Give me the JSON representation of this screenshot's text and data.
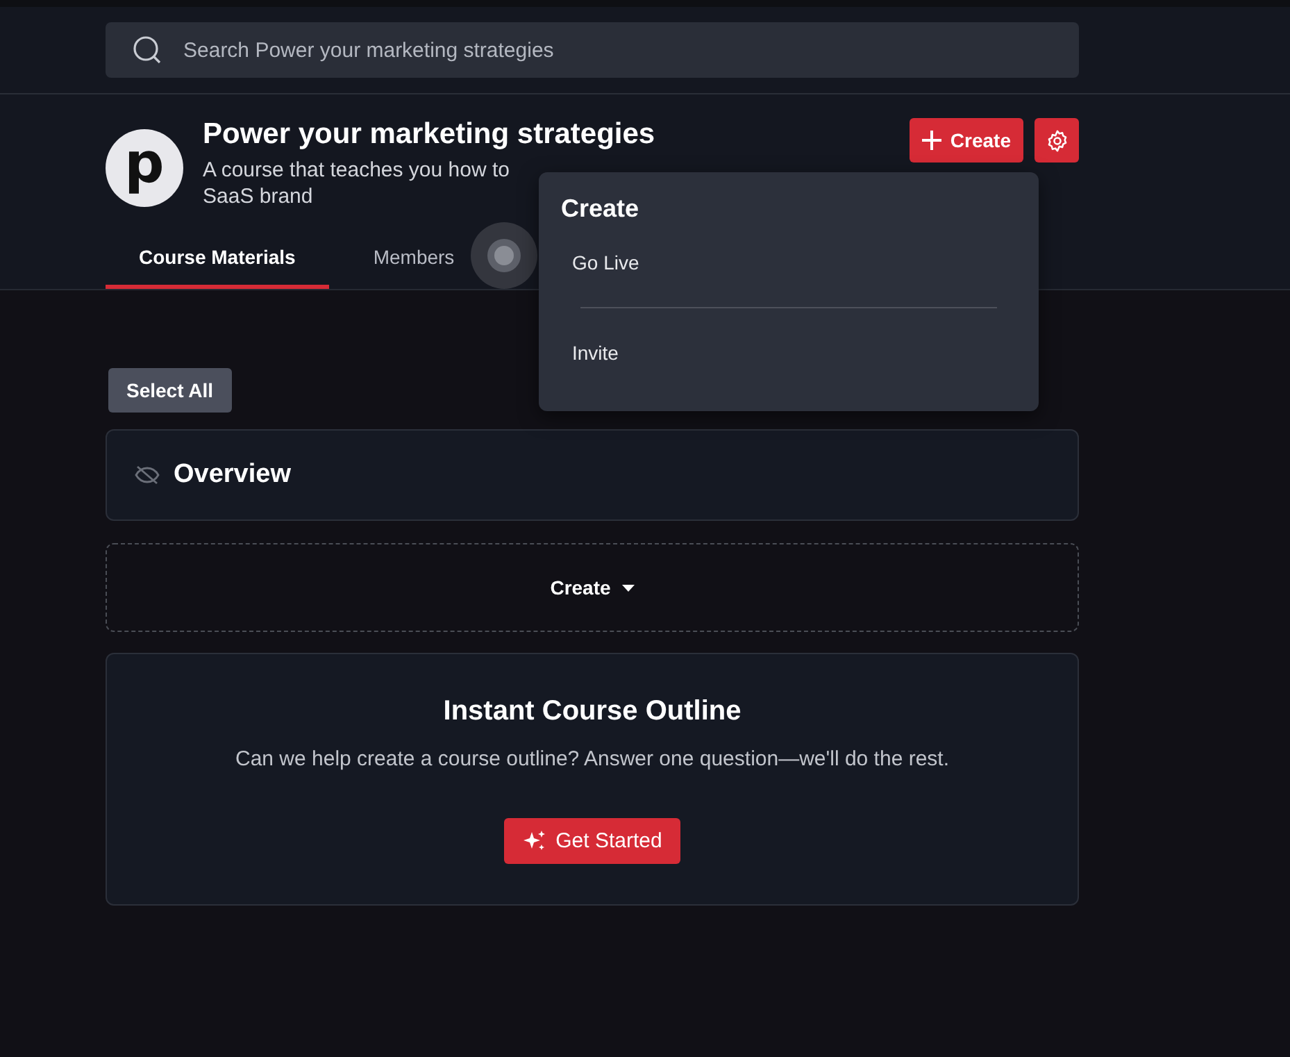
{
  "search": {
    "placeholder": "Search Power your marketing strategies"
  },
  "course": {
    "logo_letter": "p",
    "title": "Power your marketing strategies",
    "description_lines": [
      "A course that teaches you how to",
      "SaaS brand"
    ]
  },
  "header_buttons": {
    "create": "Create"
  },
  "tabs": [
    {
      "label": "Course Materials",
      "selected": true
    },
    {
      "label": "Members",
      "selected": false
    }
  ],
  "dropdown": {
    "title": "Create",
    "items": [
      "Go Live",
      "Invite"
    ]
  },
  "select_all": "Select All",
  "sections": [
    {
      "title": "Overview",
      "hidden": true
    }
  ],
  "create_menu": {
    "label": "Create"
  },
  "outline_card": {
    "title": "Instant Course Outline",
    "text": "Can we help create a course outline? Answer one question—we'll do the rest.",
    "button": "Get Started"
  }
}
